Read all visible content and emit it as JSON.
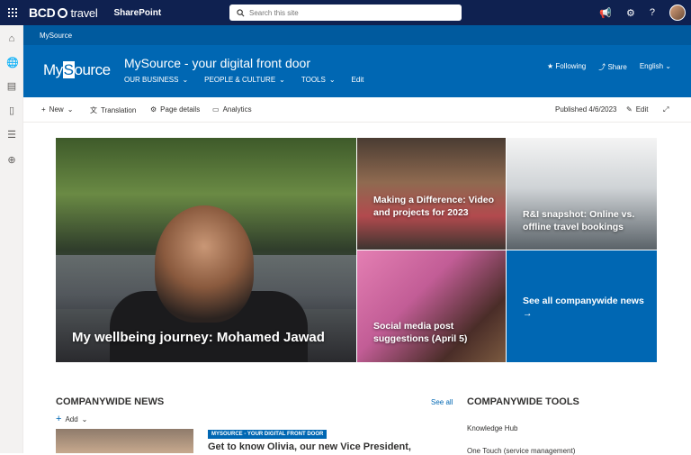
{
  "suite": {
    "brand": "BCD",
    "brand_sub": "travel",
    "app": "SharePoint",
    "search_placeholder": "Search this site"
  },
  "hub": {
    "name": "MySource"
  },
  "site": {
    "logo_text_a": "My",
    "logo_text_b": "S",
    "logo_text_c": "ource",
    "title": "MySource - your digital front door",
    "nav": [
      "OUR BUSINESS",
      "PEOPLE & CULTURE",
      "TOOLS"
    ],
    "edit": "Edit",
    "following": "Following",
    "share": "Share",
    "language": "English"
  },
  "command": {
    "new": "New",
    "translation": "Translation",
    "page_details": "Page details",
    "analytics": "Analytics",
    "published": "Published 4/6/2023",
    "edit": "Edit"
  },
  "hero": {
    "main": "My wellbeing journey: Mohamed Jawad",
    "kids": "Making a Difference: Video and projects for 2023",
    "snapshot": "R&I snapshot: Online vs. offline travel bookings",
    "social": "Social media post suggestions (April 5)",
    "see_all": "See all companywide news →"
  },
  "news": {
    "heading": "COMPANYWIDE NEWS",
    "see_all": "See all",
    "add": "Add",
    "badge": "MYSOURCE - YOUR DIGITAL FRONT DOOR",
    "item_title": "Get to know Olivia, our new Vice President,"
  },
  "tools": {
    "heading": "COMPANYWIDE TOOLS",
    "items": [
      "Knowledge Hub",
      "One Touch (service management)"
    ]
  },
  "colors": {
    "suite": "#0f2150",
    "hub": "#005a9e",
    "header": "#0067b3"
  }
}
